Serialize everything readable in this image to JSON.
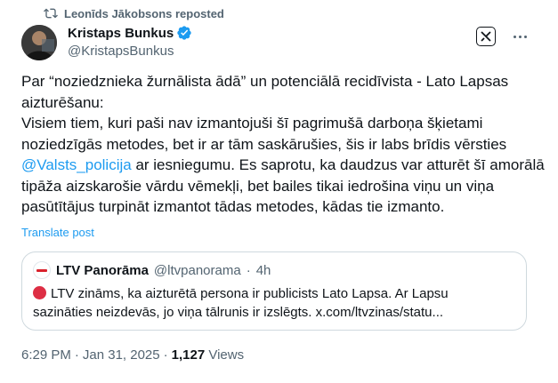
{
  "repost": {
    "text": "Leonīds Jākobsons reposted"
  },
  "author": {
    "name": "Kristaps Bunkus",
    "handle": "@KristapsBunkus"
  },
  "post": {
    "line1": "Par “noziedznieka žurnālista ādā” un potenciālā recidīvista - Lato Lapsas aizturēšanu:",
    "line2_before": "Visiem tiem, kuri paši nav izmantojuši šī pagrimušā darboņa šķietami noziedzīgās metodes, bet ir ar tām saskārušies, šis ir labs brīdis vērsties ",
    "mention": "@Valsts_policija",
    "line2_after": " ar iesniegumu. Es saprotu, ka daudzus var atturēt šī amorālā tipāža aizskarošie vārdu vēmekļi, bet bailes tikai iedrošina viņu un viņa pasūtītājus turpināt izmantot tādas metodes, kādas tie izmanto."
  },
  "translate_label": "Translate post",
  "quote": {
    "name": "LTV Panorāma",
    "handle": "@ltvpanorama",
    "dot": "·",
    "time": "4h",
    "line1": "LTV zināms, ka aizturētā persona ir publicists Lato Lapsa. Ar Lapsu",
    "line2": "sazināties neizdevās, jo viņa tālrunis ir izslēgts. x.com/ltvzinas/statu..."
  },
  "meta": {
    "time": "6:29 PM",
    "sep1": "·",
    "date": "Jan 31, 2025",
    "sep2": "·",
    "views_count": "1,127",
    "views_label": "Views"
  },
  "colors": {
    "accent": "#1d9bf0",
    "muted": "#536471",
    "text": "#0f1419",
    "border": "#cfd9de"
  },
  "icons": [
    "repost-icon",
    "verified-badge-icon",
    "grok-icon",
    "more-icon",
    "red-circle-icon"
  ]
}
